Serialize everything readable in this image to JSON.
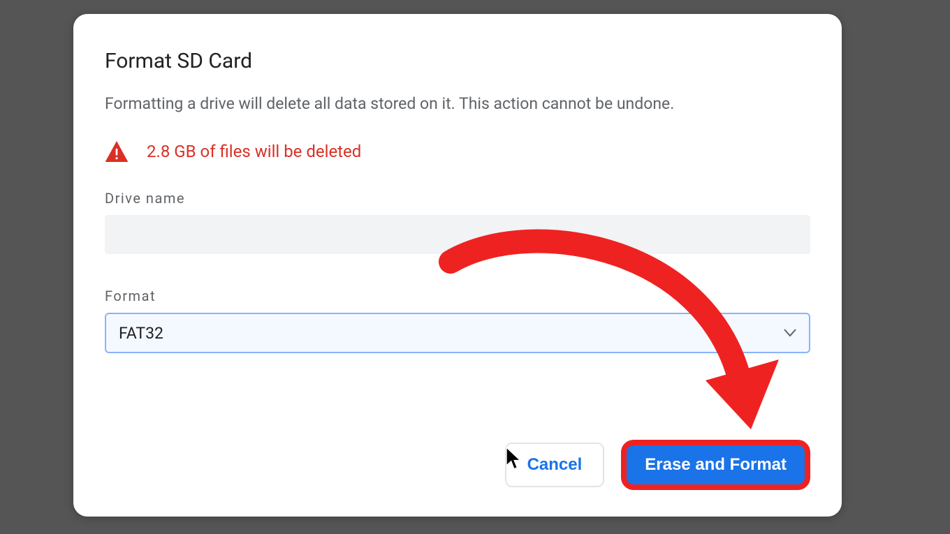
{
  "dialog": {
    "title": "Format SD Card",
    "subtitle": "Formatting a drive will delete all data stored on it. This action cannot be undone.",
    "warning_text": "2.8 GB of files will be deleted",
    "drivename_label": "Drive name",
    "drivename_value": "",
    "format_label": "Format",
    "format_value": "FAT32",
    "cancel_label": "Cancel",
    "erase_label": "Erase and Format"
  },
  "colors": {
    "accent": "#1a73e8",
    "danger": "#d93025",
    "annotation": "#ef2222"
  }
}
